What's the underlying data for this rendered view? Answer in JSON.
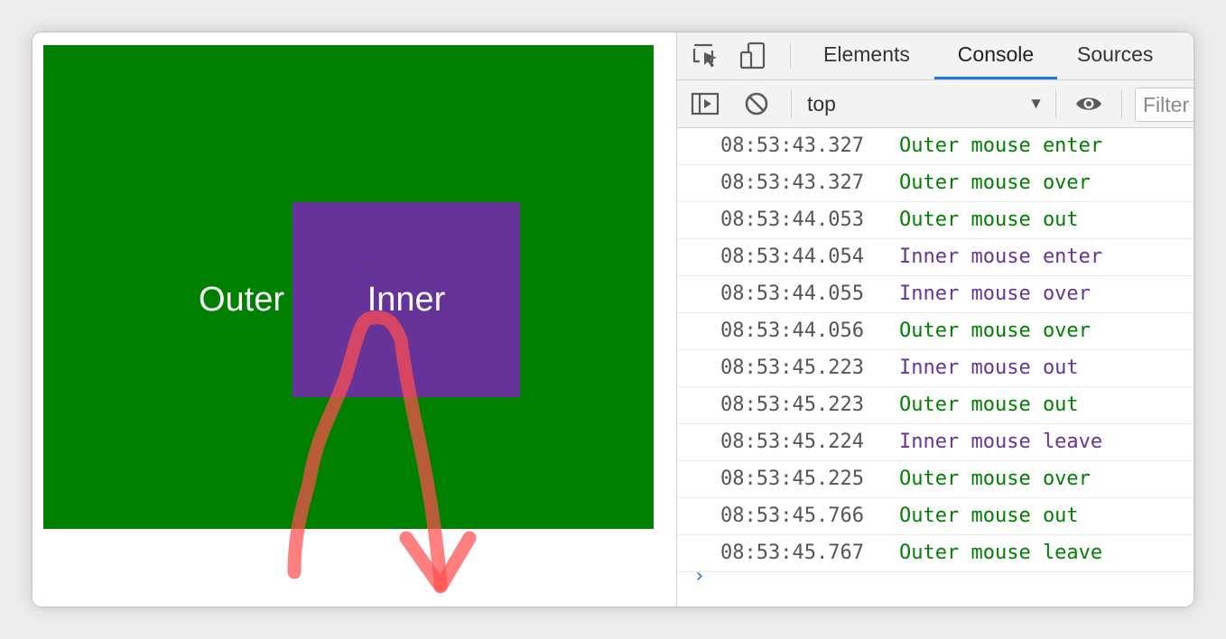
{
  "page": {
    "outer_label": "Outer",
    "inner_label": "Inner",
    "colors": {
      "outer_bg": "#008000",
      "inner_bg": "#663399",
      "gesture_stroke": "#ff4d4d"
    }
  },
  "devtools": {
    "tabs": [
      {
        "label": "Elements",
        "active": false
      },
      {
        "label": "Console",
        "active": true
      },
      {
        "label": "Sources",
        "active": false
      }
    ],
    "toolbar_icons": [
      "inspect-element-icon",
      "device-toolbar-icon"
    ],
    "console_toolbar": {
      "context": "top",
      "filter_placeholder": "Filter",
      "icons": [
        "sidebar-toggle-icon",
        "clear-console-icon",
        "eye-icon"
      ]
    },
    "colors": {
      "accent": "#1a73e8",
      "outer_log": "#008000",
      "inner_log": "#663399"
    },
    "logs": [
      {
        "time": "08:53:43.327",
        "message": "Outer mouse enter",
        "source": "outer"
      },
      {
        "time": "08:53:43.327",
        "message": "Outer mouse over",
        "source": "outer"
      },
      {
        "time": "08:53:44.053",
        "message": "Outer mouse out",
        "source": "outer"
      },
      {
        "time": "08:53:44.054",
        "message": "Inner mouse enter",
        "source": "inner"
      },
      {
        "time": "08:53:44.055",
        "message": "Inner mouse over",
        "source": "inner"
      },
      {
        "time": "08:53:44.056",
        "message": "Outer mouse over",
        "source": "outer"
      },
      {
        "time": "08:53:45.223",
        "message": "Inner mouse out",
        "source": "inner"
      },
      {
        "time": "08:53:45.223",
        "message": "Outer mouse out",
        "source": "outer"
      },
      {
        "time": "08:53:45.224",
        "message": "Inner mouse leave",
        "source": "inner"
      },
      {
        "time": "08:53:45.225",
        "message": "Outer mouse over",
        "source": "outer"
      },
      {
        "time": "08:53:45.766",
        "message": "Outer mouse out",
        "source": "outer"
      },
      {
        "time": "08:53:45.767",
        "message": "Outer mouse leave",
        "source": "outer"
      }
    ],
    "prompt_symbol": "›"
  }
}
